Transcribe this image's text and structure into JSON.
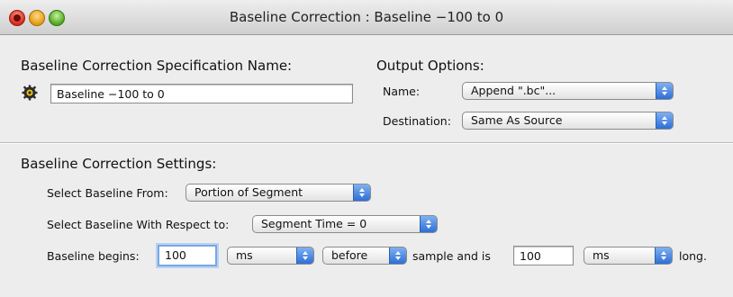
{
  "window": {
    "title": "Baseline Correction : Baseline −100 to 0"
  },
  "spec": {
    "heading": "Baseline Correction Specification Name:",
    "name_value": "Baseline −100 to 0",
    "icon": "gear-icon"
  },
  "output": {
    "heading": "Output Options:",
    "name_label": "Name:",
    "name_value": "Append \".bc\"...",
    "destination_label": "Destination:",
    "destination_value": "Same As Source"
  },
  "settings": {
    "heading": "Baseline Correction Settings:",
    "select_from_label": "Select Baseline From:",
    "select_from_value": "Portion of Segment",
    "respect_label": "Select Baseline With Respect to:",
    "respect_value": "Segment Time = 0",
    "begins_label": "Baseline begins:",
    "begins_value": "100",
    "begins_unit": "ms",
    "direction": "before",
    "sample_label": "sample and is",
    "length_value": "100",
    "length_unit": "ms",
    "long_label": "long."
  },
  "colors": {
    "stepper": "#2e6fd7",
    "focus_ring": "#7aa7e0"
  }
}
